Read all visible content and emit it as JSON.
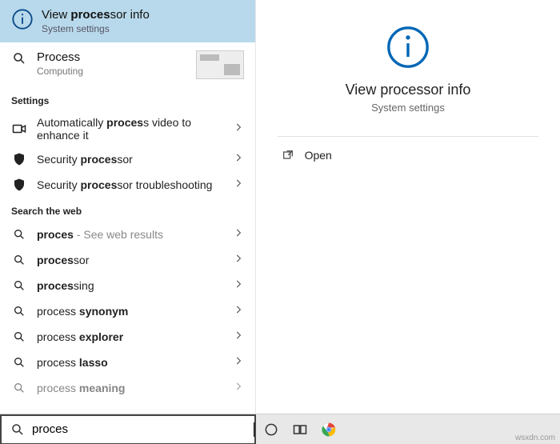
{
  "bestMatch": {
    "title_pre": "View ",
    "title_bold": "proces",
    "title_post": "sor info",
    "subtitle": "System settings"
  },
  "processEntry": {
    "title": "Process",
    "subtitle": "Computing"
  },
  "section_settings": "Settings",
  "settings": [
    {
      "pre": "Automatically ",
      "bold": "proces",
      "post": "s video to enhance it"
    },
    {
      "pre": "Security ",
      "bold": "proces",
      "post": "sor"
    },
    {
      "pre": "Security ",
      "bold": "proces",
      "post": "sor troubleshooting"
    }
  ],
  "section_web": "Search the web",
  "web": [
    {
      "pre": "",
      "bold": "proces",
      "post": "",
      "tail": " - See web results"
    },
    {
      "pre": "",
      "bold": "proces",
      "post": "sor",
      "tail": ""
    },
    {
      "pre": "",
      "bold": "proces",
      "post": "sing",
      "tail": ""
    },
    {
      "pre": "process ",
      "bold": "synonym",
      "post": "",
      "tail": ""
    },
    {
      "pre": "process ",
      "bold": "explorer",
      "post": "",
      "tail": ""
    },
    {
      "pre": "process ",
      "bold": "lasso",
      "post": "",
      "tail": ""
    },
    {
      "pre": "process ",
      "bold": "meaning",
      "post": "",
      "tail": ""
    }
  ],
  "detail": {
    "title": "View processor info",
    "subtitle": "System settings",
    "open": "Open"
  },
  "search": {
    "value": "proces"
  },
  "watermark": "wsxdn.com"
}
